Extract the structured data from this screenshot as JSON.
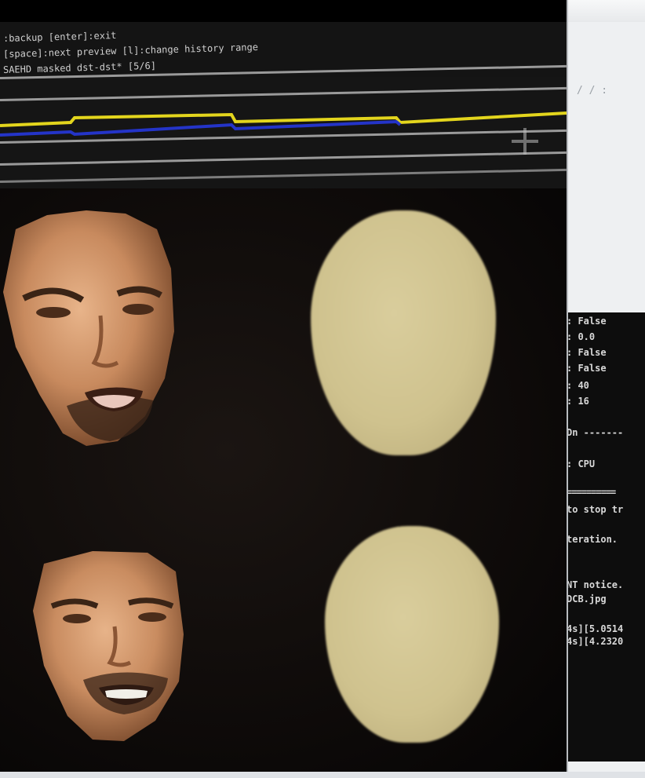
{
  "preview_window": {
    "help_lines": [
      ":backup [enter]:exit",
      "[space]:next preview [l]:change history range",
      "SAEHD masked dst-dst* [5/6]"
    ],
    "top_fragment": "..",
    "side_fragment": "/ / :"
  },
  "loss_graph": {
    "series_colors": [
      "#e3d51d",
      "#2434c8"
    ],
    "grid_color": "#9a9a9a"
  },
  "preview_panels": [
    {
      "row": "top",
      "left": "face",
      "right": "mask"
    },
    {
      "row": "bottom",
      "left": "face",
      "right": "mask"
    }
  ],
  "console": {
    "lines": [
      ": False",
      ": 0.0",
      ": False",
      ": False",
      ": 40",
      ": 16",
      "Dn -------",
      ": CPU",
      "==========",
      "to stop tr",
      "teration.",
      "NT notice.",
      "DCB.jpg",
      "4s][5.0514",
      "4s][4.2320"
    ]
  },
  "colors": {
    "mask_fill": "#cfc28e",
    "window_bg": "#000000",
    "console_bg": "#0d0d0d"
  }
}
